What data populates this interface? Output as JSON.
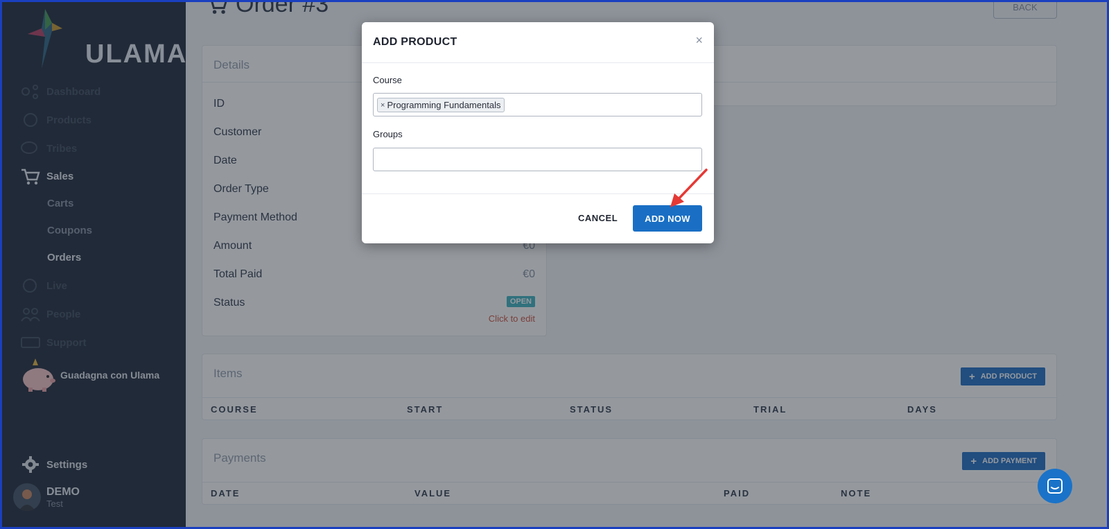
{
  "sidebar": {
    "logo_text": "ULAMA",
    "nav": [
      {
        "label": "Dashboard"
      },
      {
        "label": "Products"
      },
      {
        "label": "Tribes"
      },
      {
        "label": "Sales"
      },
      {
        "label": "Live"
      },
      {
        "label": "People"
      },
      {
        "label": "Support"
      }
    ],
    "sales_sub": [
      {
        "label": "Carts"
      },
      {
        "label": "Coupons"
      },
      {
        "label": "Orders"
      }
    ],
    "promo_label": "Guadagna con Ulama",
    "settings_label": "Settings",
    "user": {
      "name": "DEMO",
      "sub": "Test"
    }
  },
  "page": {
    "title": "Order #3",
    "back_label": "BACK"
  },
  "details": {
    "title": "Details",
    "rows": [
      {
        "label": "ID",
        "value": ""
      },
      {
        "label": "Customer",
        "value": ""
      },
      {
        "label": "Date",
        "value": ""
      },
      {
        "label": "Order Type",
        "value": ""
      },
      {
        "label": "Payment Method",
        "value": ""
      },
      {
        "label": "Amount",
        "value": "€0"
      },
      {
        "label": "Total Paid",
        "value": "€0"
      },
      {
        "label": "Status",
        "value": ""
      }
    ],
    "status_badge": "OPEN",
    "click_to_edit": "Click to edit"
  },
  "items": {
    "title": "Items",
    "add_label": "ADD PRODUCT",
    "columns": [
      "COURSE",
      "START",
      "STATUS",
      "TRIAL",
      "DAYS"
    ]
  },
  "payments": {
    "title": "Payments",
    "add_label": "ADD PAYMENT",
    "columns": [
      "DATE",
      "VALUE",
      "PAID",
      "NOTE"
    ]
  },
  "modal": {
    "title": "ADD PRODUCT",
    "close": "×",
    "course_label": "Course",
    "course_chip": "Programming Fundamentals",
    "groups_label": "Groups",
    "groups_value": "",
    "cancel_label": "CANCEL",
    "submit_label": "ADD NOW"
  },
  "colors": {
    "sidebar_bg": "#2c3646",
    "primary": "#1a6fc4",
    "status_open": "#48b6c4",
    "annotation_arrow": "#e53935"
  }
}
